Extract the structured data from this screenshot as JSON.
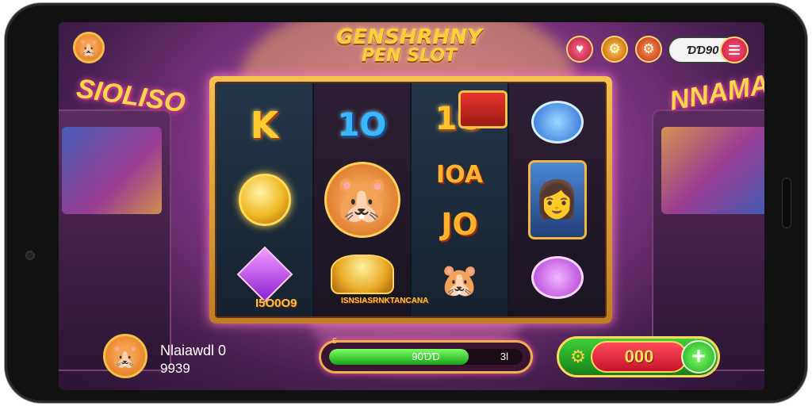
{
  "game": {
    "title_line1": "GENSHRHNY",
    "title_line2": "PEN SLOT"
  },
  "background_signs": {
    "left": "SIOLISO",
    "right": "NNAMA"
  },
  "top_bar": {
    "avatar_icon": "hamster-face-icon",
    "buttons": [
      {
        "name": "heart-button",
        "icon": "♥"
      },
      {
        "name": "settings-button",
        "icon": "⚙"
      },
      {
        "name": "gift-button",
        "icon": "⚙"
      }
    ],
    "coin_balance": "ƊƊ90",
    "menu_icon": "hamburger-menu-icon"
  },
  "reels": [
    {
      "symbols": [
        "K",
        "gold-coin-icon",
        "purple-gem-icon"
      ],
      "label": "I5O0O9"
    },
    {
      "symbols": [
        "1O",
        "hamster-badge-icon",
        "coin-pile-icon"
      ],
      "label": "ISNSIASRNKTANCANA"
    },
    {
      "symbols": [
        "1O",
        "IOA",
        "JO"
      ],
      "extra_symbols": [
        "treasure-chest-icon",
        "hamster-icon"
      ]
    },
    {
      "symbols": [
        "blue-chip-icon",
        "woman-portrait-icon",
        "purple-chip-icon"
      ]
    }
  ],
  "player": {
    "name": "Nlaiawdl 0",
    "score": "9939"
  },
  "progress": {
    "label": "90ƊƊ",
    "end_label": "3l",
    "fraction": 0.72,
    "marker": "Ɛ"
  },
  "bet": {
    "value": "000",
    "plus_label": "+"
  },
  "colors": {
    "accent_gold": "#ffc12e",
    "bet_red": "#e8253b",
    "bet_green": "#2bbf2a",
    "background_purple": "#8d3a8e"
  }
}
